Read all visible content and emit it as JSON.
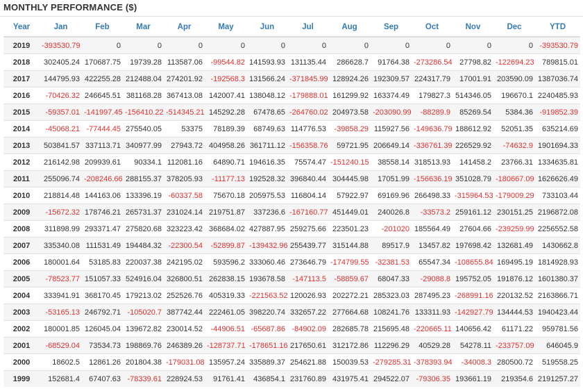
{
  "title": "MONTHLY PERFORMANCE ($)",
  "colors": {
    "header_text": "#337ab7",
    "negative": "#e03030",
    "stripe": "#f5f5f5"
  },
  "headers": [
    "Year",
    "Jan",
    "Feb",
    "Mar",
    "Apr",
    "May",
    "Jun",
    "Jul",
    "Aug",
    "Sep",
    "Oct",
    "Nov",
    "Dec",
    "YTD"
  ],
  "rows": [
    [
      "2019",
      "-393530.79",
      "0",
      "0",
      "0",
      "0",
      "0",
      "0",
      "0",
      "0",
      "0",
      "0",
      "0",
      "-393530.79"
    ],
    [
      "2018",
      "302405.24",
      "170687.75",
      "19739.28",
      "113587.06",
      "-99544.82",
      "141593.93",
      "131135.44",
      "286628.7",
      "91764.38",
      "-273286.54",
      "27798.82",
      "-122694.23",
      "789815.01"
    ],
    [
      "2017",
      "144795.93",
      "422255.28",
      "212488.04",
      "274201.92",
      "-192568.3",
      "131566.24",
      "-371845.99",
      "128924.26",
      "192309.57",
      "224317.79",
      "17001.91",
      "203590.09",
      "1387036.74"
    ],
    [
      "2016",
      "-70426.32",
      "246645.51",
      "381168.28",
      "367413.08",
      "142007.41",
      "138048.12",
      "-179888.01",
      "161299.92",
      "163374.49",
      "179827.3",
      "514346.05",
      "196670.1",
      "2240485.93"
    ],
    [
      "2015",
      "-59357.01",
      "-141997.45",
      "-156410.22",
      "-514345.21",
      "145292.28",
      "67478.65",
      "-264760.02",
      "204973.58",
      "-203090.99",
      "-88289.9",
      "85269.54",
      "5384.36",
      "-919852.39"
    ],
    [
      "2014",
      "-45068.21",
      "-77444.45",
      "275540.05",
      "53375",
      "78189.39",
      "68749.63",
      "114776.53",
      "-39858.29",
      "115927.56",
      "-149636.79",
      "188612.92",
      "52051.35",
      "635214.69"
    ],
    [
      "2013",
      "503841.57",
      "337113.71",
      "340977.99",
      "27943.72",
      "404958.26",
      "361711.12",
      "-156358.76",
      "59721.95",
      "206649.14",
      "-336761.39",
      "226529.92",
      "-74632.9",
      "1901694.33"
    ],
    [
      "2012",
      "216142.98",
      "209939.61",
      "90334.1",
      "112081.16",
      "64890.71",
      "194616.35",
      "75574.47",
      "-151240.15",
      "38558.14",
      "318513.93",
      "141458.2",
      "23766.31",
      "1334635.81"
    ],
    [
      "2011",
      "255096.74",
      "-208246.66",
      "288155.37",
      "378205.93",
      "-11177.13",
      "192528.32",
      "396840.44",
      "304445.98",
      "17051.99",
      "-156636.19",
      "351028.79",
      "-180667.09",
      "1626626.49"
    ],
    [
      "2010",
      "218814.48",
      "144163.06",
      "133396.19",
      "-60337.58",
      "75670.18",
      "205975.53",
      "116804.14",
      "57922.97",
      "69169.96",
      "266498.33",
      "-315964.53",
      "-179009.29",
      "733103.44"
    ],
    [
      "2009",
      "-15672.32",
      "178746.21",
      "265731.37",
      "231024.14",
      "219751.87",
      "337236.6",
      "-167160.77",
      "451449.01",
      "240026.8",
      "-33573.2",
      "259161.12",
      "230151.25",
      "2196872.08"
    ],
    [
      "2008",
      "311898.99",
      "293371.47",
      "275820.68",
      "323223.42",
      "368684.02",
      "427887.95",
      "259275.66",
      "223501.23",
      "-201020",
      "185564.49",
      "27604.66",
      "-239259.99",
      "2256552.58"
    ],
    [
      "2007",
      "335340.08",
      "111531.49",
      "194484.32",
      "-22300.54",
      "-52899.87",
      "-139432.96",
      "255439.77",
      "315144.88",
      "89517.9",
      "13457.82",
      "197698.42",
      "132681.49",
      "1430662.8"
    ],
    [
      "2006",
      "180001.64",
      "53185.83",
      "220037.38",
      "242195.02",
      "593596.2",
      "333060.46",
      "273646.79",
      "-174799.55",
      "-32381.53",
      "65547.34",
      "-108655.84",
      "169495.19",
      "1814928.93"
    ],
    [
      "2005",
      "-78523.77",
      "151057.33",
      "524916.04",
      "326800.51",
      "262838.15",
      "193678.58",
      "-147113.5",
      "-58859.67",
      "68047.33",
      "-29088.8",
      "195752.05",
      "191876.12",
      "1601380.37"
    ],
    [
      "2004",
      "333941.91",
      "368170.45",
      "179213.02",
      "252526.76",
      "405319.33",
      "-221563.52",
      "120026.93",
      "202272.21",
      "285323.03",
      "287495.23",
      "-268991.16",
      "220132.52",
      "2163866.71"
    ],
    [
      "2003",
      "-53165.13",
      "246792.71",
      "-105020.7",
      "387742.44",
      "222461.05",
      "398220.74",
      "332657.22",
      "277664.68",
      "108241.76",
      "133311.93",
      "-142927.79",
      "134444.53",
      "1940423.44"
    ],
    [
      "2002",
      "180001.85",
      "126045.04",
      "139672.82",
      "230014.52",
      "-44906.51",
      "-65687.86",
      "-84902.09",
      "282685.78",
      "215695.48",
      "-220665.11",
      "140656.42",
      "61171.22",
      "959781.56"
    ],
    [
      "2001",
      "-68529.04",
      "73534.73",
      "198869.76",
      "246389.26",
      "-128737.71",
      "-178651.16",
      "217650.61",
      "312172.86",
      "112296.29",
      "40529.28",
      "54278.11",
      "-233757.09",
      "646045.9"
    ],
    [
      "2000",
      "18602.5",
      "12861.26",
      "201804.38",
      "-179031.08",
      "135957.24",
      "335889.37",
      "254621.88",
      "150039.53",
      "-279285.31",
      "-378393.94",
      "-34008.3",
      "280500.72",
      "519558.25"
    ],
    [
      "1999",
      "152681.4",
      "67407.63",
      "-78339.61",
      "228924.53",
      "91761.41",
      "436854.1",
      "231760.89",
      "431975.41",
      "294522.07",
      "-79306.35",
      "193661.19",
      "219354.6",
      "2191257.27"
    ]
  ]
}
